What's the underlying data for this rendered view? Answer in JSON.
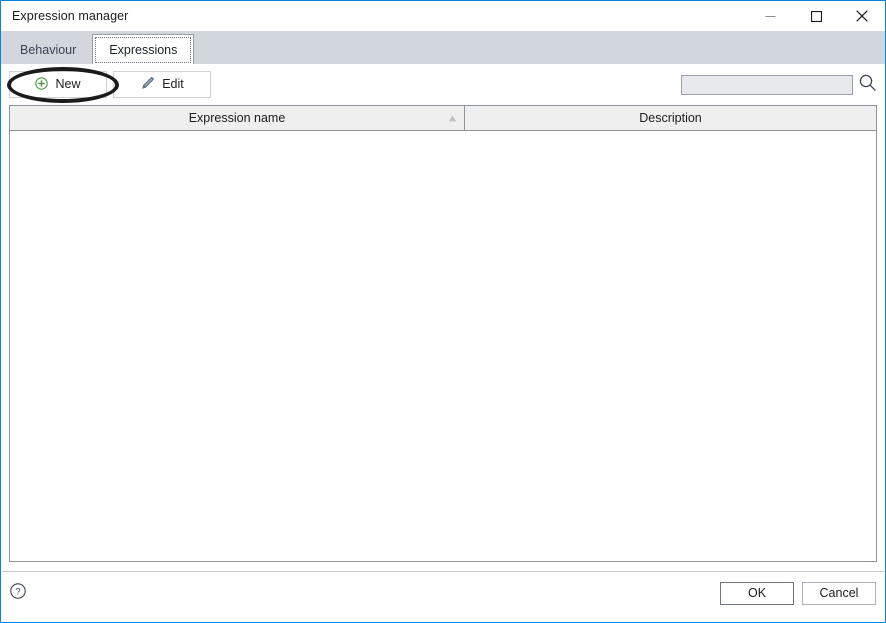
{
  "window": {
    "title": "Expression manager",
    "controls": {
      "minimize": "minimize-button",
      "maximize": "maximize-button",
      "close": "close-button"
    }
  },
  "tabs": [
    {
      "label": "Behaviour",
      "active": false
    },
    {
      "label": "Expressions",
      "active": true
    }
  ],
  "toolbar": {
    "new_label": "New",
    "new_icon": "plus-circle-icon",
    "edit_label": "Edit",
    "edit_icon": "pencil-icon",
    "search": {
      "value": "",
      "placeholder": "",
      "icon": "search-icon"
    }
  },
  "list": {
    "columns": [
      {
        "header": "Expression name",
        "sort": "ascending"
      },
      {
        "header": "Description",
        "sort": "none"
      }
    ],
    "rows": []
  },
  "footer": {
    "help_icon": "help-circle-icon",
    "ok_label": "OK",
    "cancel_label": "Cancel"
  },
  "annotation": {
    "type": "highlight-oval",
    "target": "new-button",
    "color": "#1b1b1b"
  },
  "colors": {
    "window_border": "#0a84d8",
    "tabstrip_bg": "#d2d7de",
    "header_bg": "#efefef",
    "panel_border": "#8f949b",
    "search_bg": "#e7e9ec",
    "new_icon_green": "#4f9b43"
  }
}
